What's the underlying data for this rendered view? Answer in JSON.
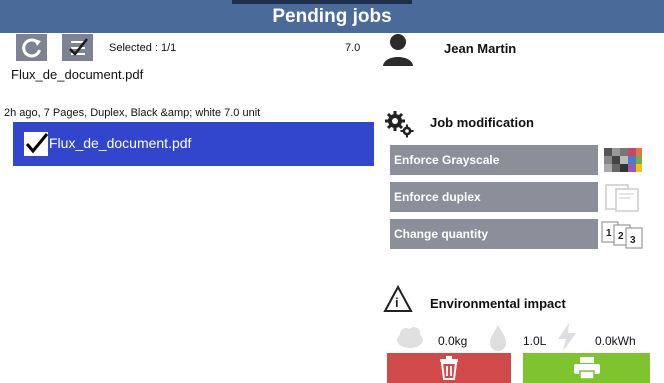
{
  "header": {
    "title": "Pending jobs"
  },
  "toolbar": {
    "selected_label": "Selected : 1/1"
  },
  "user": {
    "count": "7.0",
    "name": "Jean Martin"
  },
  "document": {
    "name": "Flux_de_document.pdf"
  },
  "job": {
    "info": "2h ago, 7 Pages, Duplex, Black &amp; white  7.0  unit",
    "name": "Flux_de_document.pdf",
    "checked": true
  },
  "modification": {
    "title": "Job modification",
    "enforce_grayscale": "Enforce Grayscale",
    "enforce_duplex": "Enforce duplex",
    "change_quantity": "Change quantity"
  },
  "environment": {
    "title": "Environmental impact",
    "co2": "0.0kg",
    "water": "1.0L",
    "energy": "0.0kWh"
  },
  "colors": {
    "header": "#4a6a9a",
    "selection": "#3146cc",
    "delete": "#d04a4a",
    "print": "#7ec42f",
    "button_gray": "#8a8f9a"
  },
  "icons": {
    "refresh": "refresh-icon",
    "select_all": "select-all-icon",
    "user": "user-icon",
    "checkbox": "checkbox-checked-icon",
    "gears": "gears-icon",
    "leaf": "leaf-recycle-icon",
    "co2": "co2-cloud-icon",
    "water": "water-drop-icon",
    "energy": "lightning-icon",
    "trash": "trash-icon",
    "printer": "printer-icon"
  }
}
